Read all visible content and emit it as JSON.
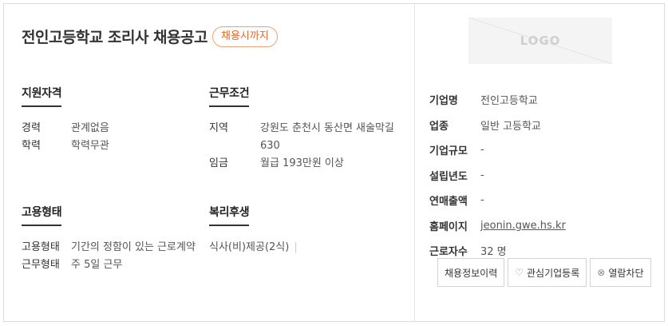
{
  "header": {
    "title": "전인고등학교 조리사 채용공고",
    "badge": "채용시까지"
  },
  "sections": {
    "qualification": {
      "title": "지원자격",
      "rows": [
        {
          "k": "경력",
          "v": "관계없음"
        },
        {
          "k": "학력",
          "v": "학력무관"
        }
      ]
    },
    "conditions": {
      "title": "근무조건",
      "rows": [
        {
          "k": "지역",
          "v": "강원도 춘천시 동산면 새술막길",
          "v2": "630"
        },
        {
          "k": "임금",
          "v": "월급 193만원 이상"
        }
      ]
    },
    "employment": {
      "title": "고용형태",
      "rows": [
        {
          "k": "고용형태",
          "v": "기간의 정함이 있는 근로계약"
        },
        {
          "k": "근무형태",
          "v": "주 5일 근무"
        }
      ]
    },
    "welfare": {
      "title": "복리후생",
      "value": "식사(비)제공(2식)",
      "sep": "|"
    }
  },
  "company": {
    "logo_text": "LOGO",
    "rows": [
      {
        "k": "기업명",
        "v": "전인고등학교"
      },
      {
        "k": "업종",
        "v": "일반 고등학교"
      },
      {
        "k": "기업규모",
        "v": "-"
      },
      {
        "k": "설립년도",
        "v": "-"
      },
      {
        "k": "연매출액",
        "v": "-"
      },
      {
        "k": "홈페이지",
        "v": "jeonin.gwe.hs.kr"
      },
      {
        "k": "근로자수",
        "v": "32 명"
      }
    ]
  },
  "actions": {
    "history": "채용정보이력",
    "interest": "관심기업등록",
    "block": "열람차단",
    "interest_icon": "heart-icon",
    "block_icon": "block-icon"
  }
}
